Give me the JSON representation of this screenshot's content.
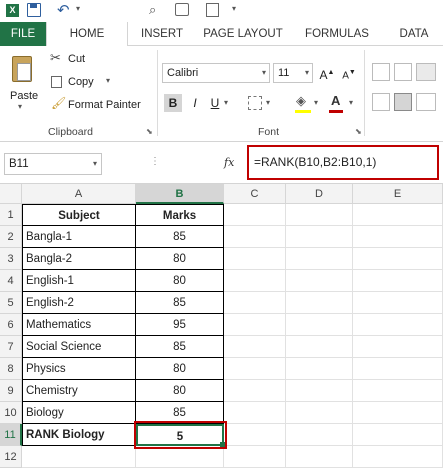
{
  "ribbon": {
    "tabs": [
      "FILE",
      "HOME",
      "INSERT",
      "PAGE LAYOUT",
      "FORMULAS",
      "DATA"
    ],
    "clipboard": {
      "paste": "Paste",
      "cut": "Cut",
      "copy": "Copy",
      "format_painter": "Format Painter",
      "group_label": "Clipboard"
    },
    "font": {
      "name": "Calibri",
      "size": "11",
      "group_label": "Font"
    }
  },
  "formula_bar": {
    "name_box": "B11",
    "fx": "fx",
    "formula": "=RANK(B10,B2:B10,1)"
  },
  "sheet": {
    "columns": [
      "A",
      "B",
      "C",
      "D",
      "E"
    ],
    "rows": [
      "1",
      "2",
      "3",
      "4",
      "5",
      "6",
      "7",
      "8",
      "9",
      "10",
      "11",
      "12"
    ],
    "header": {
      "subject": "Subject",
      "marks": "Marks"
    },
    "data": [
      {
        "subject": "Bangla-1",
        "marks": "85"
      },
      {
        "subject": "Bangla-2",
        "marks": "80"
      },
      {
        "subject": "English-1",
        "marks": "80"
      },
      {
        "subject": "English-2",
        "marks": "85"
      },
      {
        "subject": "Mathematics",
        "marks": "95"
      },
      {
        "subject": "Social Science",
        "marks": "85"
      },
      {
        "subject": "Physics",
        "marks": "80"
      },
      {
        "subject": "Chemistry",
        "marks": "80"
      },
      {
        "subject": "Biology",
        "marks": "85"
      }
    ],
    "rank_row": {
      "label": "RANK Biology",
      "value": "5"
    }
  },
  "colors": {
    "accent": "#217346",
    "highlight": "#c00000"
  }
}
